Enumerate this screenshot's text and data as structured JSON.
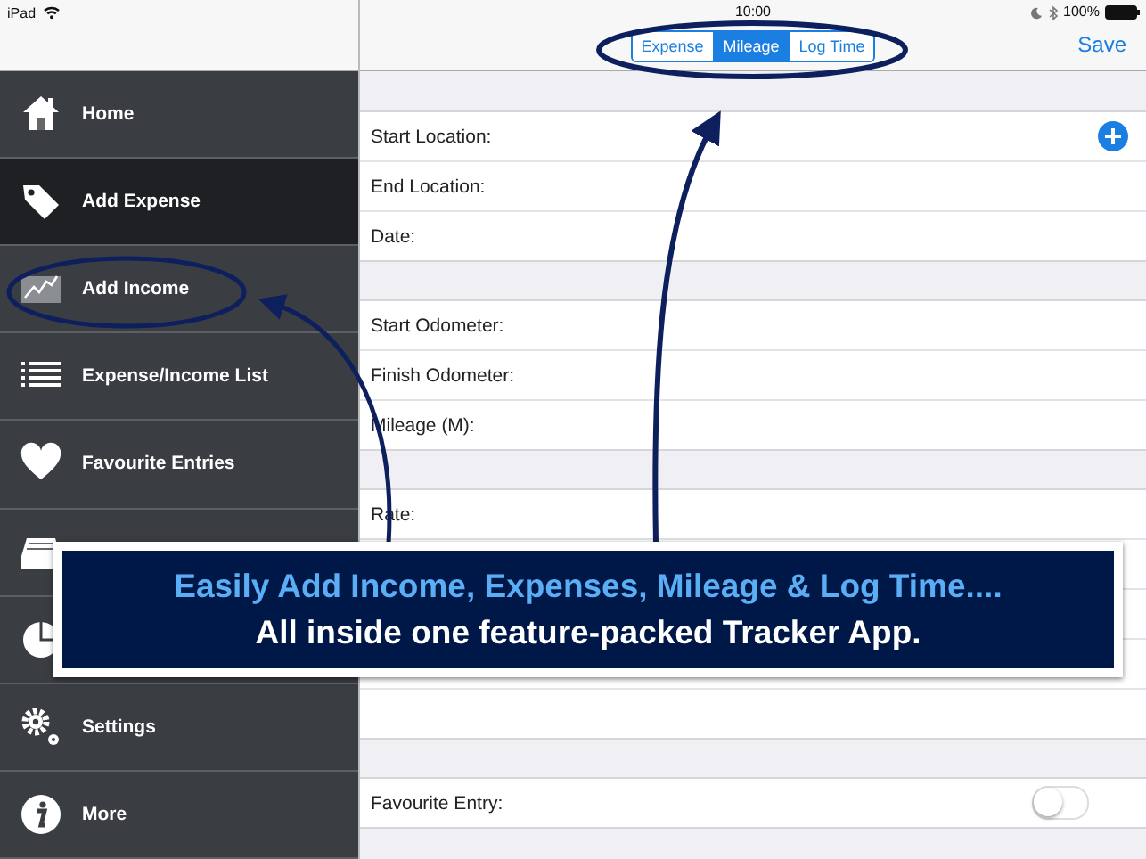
{
  "status_bar": {
    "device": "iPad",
    "time": "10:00",
    "battery": "100%"
  },
  "nav_bar": {
    "segments": [
      {
        "label": "Expense",
        "selected": false
      },
      {
        "label": "Mileage",
        "selected": true
      },
      {
        "label": "Log Time",
        "selected": false
      }
    ],
    "save": "Save"
  },
  "sidebar": {
    "items": [
      {
        "kind": "home",
        "label": "Home",
        "selected": false
      },
      {
        "kind": "tag",
        "label": "Add Expense",
        "selected": true
      },
      {
        "kind": "chart",
        "label": "Add Income",
        "selected": false
      },
      {
        "kind": "list",
        "label": "Expense/Income List",
        "selected": false
      },
      {
        "kind": "heart",
        "label": "Favourite Entries",
        "selected": false
      },
      {
        "kind": "tray"
      },
      {
        "kind": "pie"
      },
      {
        "kind": "gear",
        "label": "Settings",
        "selected": false
      },
      {
        "kind": "info",
        "label": "More",
        "selected": false
      }
    ]
  },
  "form": {
    "groups": [
      [
        {
          "kind": "add",
          "label": "Start Location:"
        },
        {
          "kind": "text",
          "label": "End Location:"
        },
        {
          "kind": "text",
          "label": "Date:"
        }
      ],
      [
        {
          "kind": "text",
          "label": "Start Odometer:"
        },
        {
          "kind": "text",
          "label": "Finish Odometer:"
        },
        {
          "kind": "text",
          "label": "Mileage (M):"
        }
      ],
      [
        {
          "kind": "text",
          "label": "Rate:"
        },
        {
          "kind": "text"
        },
        {
          "kind": "text"
        },
        {
          "kind": "text"
        },
        {
          "kind": "text"
        }
      ],
      [
        {
          "kind": "toggle",
          "label": "Favourite Entry:",
          "on": false
        }
      ]
    ]
  },
  "banner": {
    "headline": "Easily Add Income, Expenses, Mileage & Log Time....",
    "subline": "All inside one feature-packed Tracker App."
  }
}
